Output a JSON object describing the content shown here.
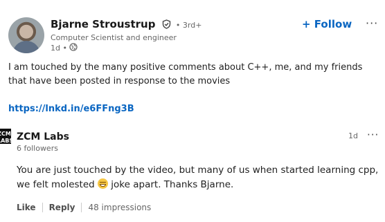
{
  "post": {
    "author_name": "Bjarne Stroustrup",
    "degree": "• 3rd+",
    "headline": "Computer Scientist and engineer",
    "time": "1d •",
    "follow_label": "+ Follow",
    "more_label": "···",
    "body": "I am touched by the many positive comments about C++, me, and my friends that have been posted in response to the movies",
    "link": "https://lnkd.in/e6FFng3B"
  },
  "comment": {
    "avatar_text": "ZCM LABS",
    "author_name": "ZCM Labs",
    "followers": "6 followers",
    "time": "1d",
    "more_label": "···",
    "text_before": "You are just touched by the video, but many of us when started learning cpp, we felt molested ",
    "text_after": " joke apart. Thanks Bjarne.",
    "like_label": "Like",
    "reply_label": "Reply",
    "impressions": "48 impressions"
  }
}
